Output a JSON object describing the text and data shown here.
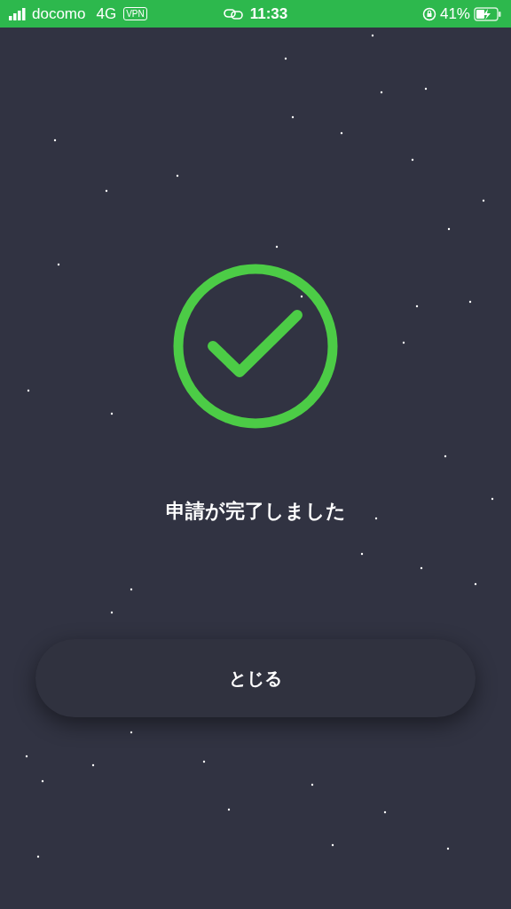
{
  "status_bar": {
    "carrier": "docomo",
    "network": "4G",
    "vpn": "VPN",
    "time": "11:33",
    "battery": "41%"
  },
  "message": "申請が完了しました",
  "close_button": "とじる"
}
